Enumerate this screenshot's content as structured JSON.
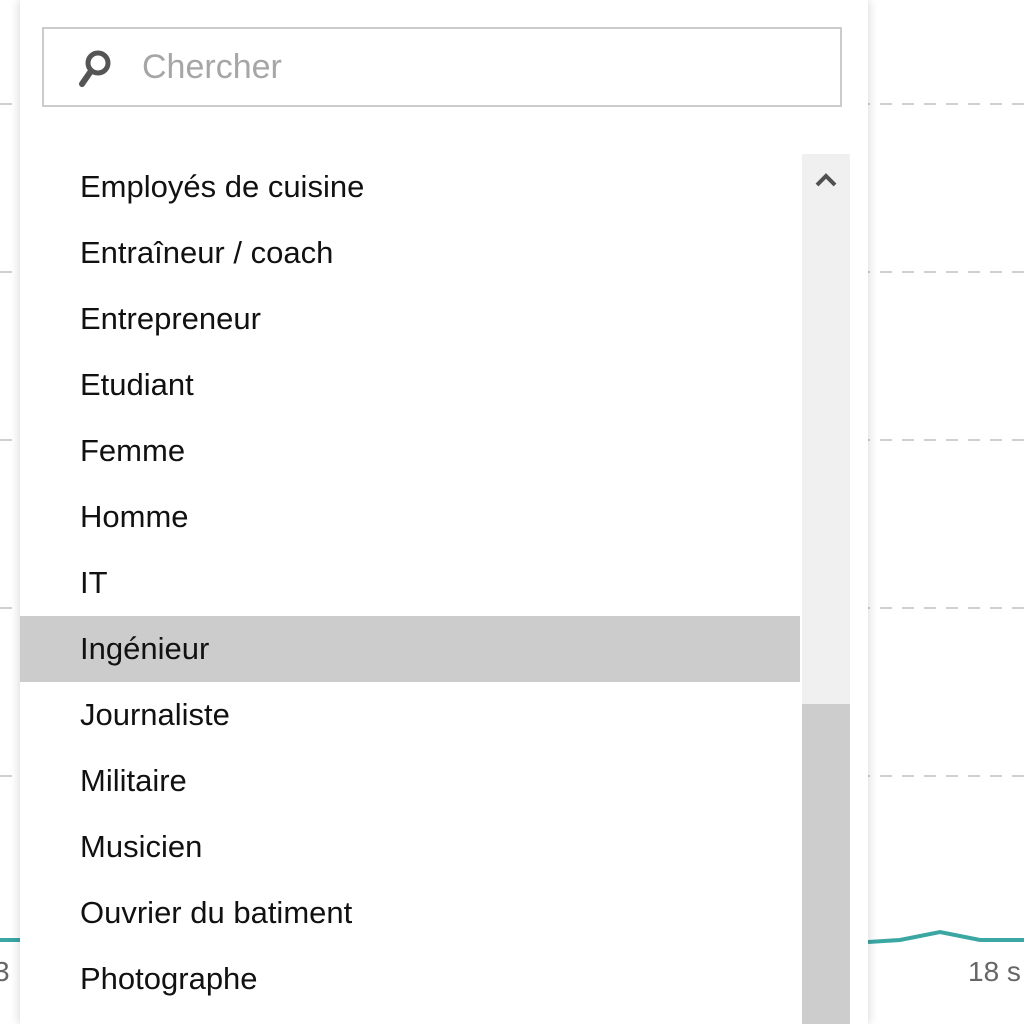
{
  "search": {
    "placeholder": "Chercher"
  },
  "list": {
    "items": [
      "Employés de cuisine",
      "Entraîneur / coach",
      "Entrepreneur",
      "Etudiant",
      "Femme",
      "Homme",
      "IT",
      "Ingénieur",
      "Journaliste",
      "Militaire",
      "Musicien",
      "Ouvrier du batiment",
      "Photographe"
    ],
    "highlighted": "Ingénieur"
  },
  "background": {
    "axis_left_fragment": "3",
    "axis_right_fragment": "18 s"
  },
  "colors": {
    "highlight": "#cccccc",
    "line": "#3aa7a3",
    "grid": "#d0d0d0"
  },
  "icons": {
    "search": "search-icon",
    "scroll_up": "chevron-up-icon"
  }
}
